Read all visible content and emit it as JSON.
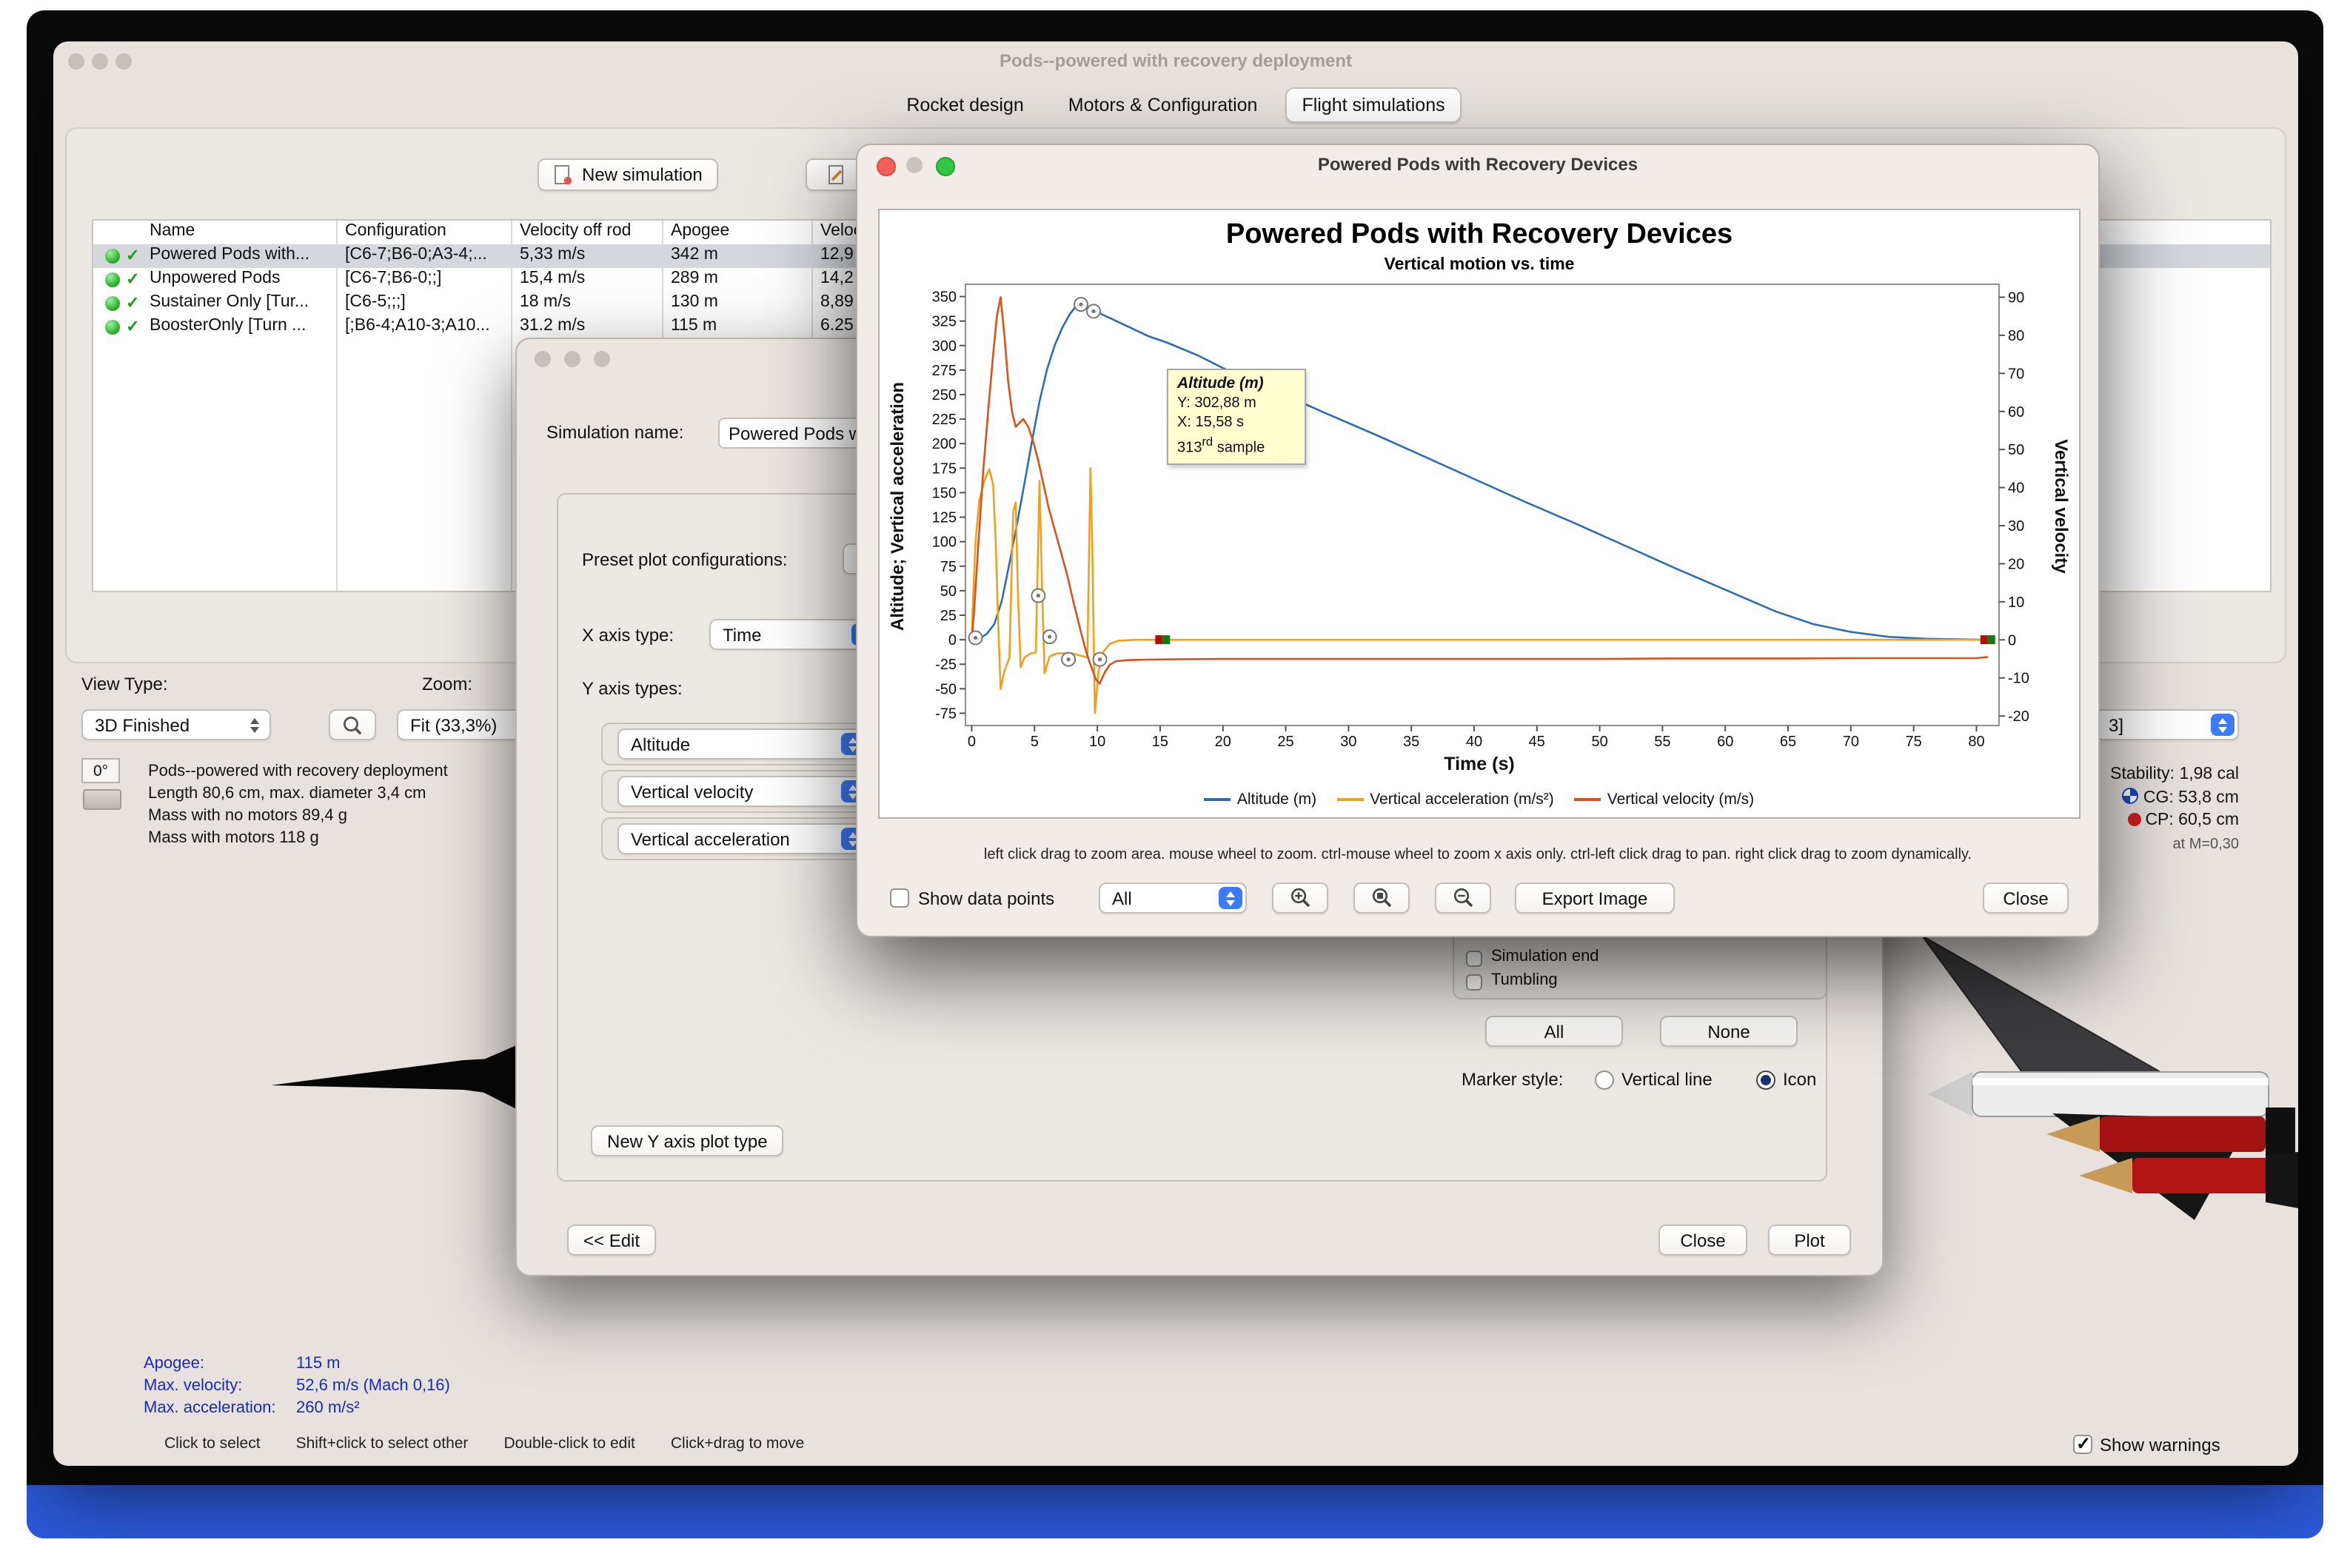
{
  "colors": {
    "accent_blue": "#3d7af5",
    "dock_blue": "#2b59d8",
    "selection": "#d4d8dc",
    "altitude": "#2e6db4",
    "acceleration": "#f0a01e",
    "velocity": "#d8521a"
  },
  "window": {
    "title": "Pods--powered with recovery deployment",
    "tabs": [
      "Rocket design",
      "Motors & Configuration",
      "Flight simulations"
    ],
    "active_tab": "Flight simulations",
    "toolbar": {
      "new_simulation": "New simulation",
      "edit_fragment": "E"
    },
    "table": {
      "columns": [
        "Name",
        "Configuration",
        "Velocity off rod",
        "Apogee",
        "Veloc"
      ],
      "rows": [
        {
          "name": "Powered Pods with...",
          "configuration": "[C6-7;B6-0;A3-4;...",
          "velocity_off_rod": "5,33 m/s",
          "apogee": "342 m",
          "velocity_deploy": "12,9"
        },
        {
          "name": "Unpowered Pods",
          "configuration": "[C6-7;B6-0;;]",
          "velocity_off_rod": "15,4 m/s",
          "apogee": "289 m",
          "velocity_deploy": "14,2"
        },
        {
          "name": "Sustainer Only [Tur...",
          "configuration": "[C6-5;;;]",
          "velocity_off_rod": "18 m/s",
          "apogee": "130 m",
          "velocity_deploy": "8,89"
        },
        {
          "name": "BoosterOnly [Turn ...",
          "configuration": "[;B6-4;A10-3;A10...",
          "velocity_off_rod": "31.2 m/s",
          "apogee": "115 m",
          "velocity_deploy": "6.25"
        }
      ]
    },
    "view": {
      "view_type_label": "View Type:",
      "view_type_value": "3D Finished",
      "zoom_label": "Zoom:",
      "zoom_value": "Fit (33,3%)",
      "rotation": "0°"
    },
    "rocket_info": [
      "Pods--powered with recovery deployment",
      "Length 80,6 cm, max. diameter 3,4 cm",
      "Mass with no motors 89,4 g",
      "Mass with motors 118 g"
    ],
    "flight_stats": {
      "apogee_label": "Apogee:",
      "apogee_value": "115 m",
      "velocity_label": "Max. velocity:",
      "velocity_value": "52,6 m/s  (Mach 0,16)",
      "accel_label": "Max. acceleration:",
      "accel_value": "260 m/s²"
    },
    "stability": {
      "config_fragment": "3]",
      "stability": "Stability: 1,98 cal",
      "cg": "CG: 53,8 cm",
      "cp": "CP: 60,5 cm",
      "mach": "at M=0,30"
    },
    "status_bar": {
      "hints": [
        "Click to select",
        "Shift+click to select other",
        "Double-click to edit",
        "Click+drag to move"
      ],
      "show_warnings": "Show warnings"
    }
  },
  "edit_dialog": {
    "simulation_name_label": "Simulation name:",
    "simulation_name_value": "Powered Pods w",
    "preset_label": "Preset plot configurations:",
    "x_axis_label": "X axis type:",
    "x_axis_value": "Time",
    "y_axis_label": "Y axis types:",
    "y_axis_types": [
      "Altitude",
      "Vertical velocity",
      "Vertical acceleration"
    ],
    "events": [
      "Simulation end",
      "Tumbling"
    ],
    "all_button": "All",
    "none_button": "None",
    "marker_style_label": "Marker style:",
    "marker_options": [
      "Vertical line",
      "Icon"
    ],
    "marker_selected": "Icon",
    "new_y_axis_button": "New Y axis plot type",
    "edit_button": "<< Edit",
    "close_button": "Close",
    "plot_button": "Plot"
  },
  "plot_dialog": {
    "title": "Powered Pods with Recovery Devices",
    "hint": "left click drag to zoom area. mouse wheel to zoom. ctrl-mouse wheel to zoom x axis only. ctrl-left click drag to pan.  right click drag to zoom dynamically.",
    "show_data_points": "Show data points",
    "events_dropdown": "All",
    "export_button": "Export Image",
    "close_button": "Close",
    "tooltip": {
      "title": "Altitude (m)",
      "y_line": "Y: 302,88 m",
      "x_line": "X: 15,58 s",
      "sample_num": "313",
      "sample_sup": "rd",
      "sample_word": " sample"
    }
  },
  "chart_data": {
    "type": "line",
    "title": "Powered Pods with Recovery Devices",
    "subtitle": "Vertical motion vs. time",
    "xlabel": "Time (s)",
    "ylabel_left": "Altitude; Vertical acceleration",
    "ylabel_right": "Vertical velocity",
    "xlim": [
      -0.5,
      81.8
    ],
    "ylim_left": [
      -87.5,
      362.5
    ],
    "ylim_right": [
      -22.5,
      93.4
    ],
    "x_ticks": [
      0,
      5,
      10,
      15,
      20,
      25,
      30,
      35,
      40,
      45,
      50,
      55,
      60,
      65,
      70,
      75,
      80
    ],
    "left_ticks": [
      -75,
      -50,
      -25,
      0,
      25,
      50,
      75,
      100,
      125,
      150,
      175,
      200,
      225,
      250,
      275,
      300,
      325,
      350
    ],
    "right_ticks": [
      -20,
      -10,
      0,
      10,
      20,
      30,
      40,
      50,
      60,
      70,
      80,
      90
    ],
    "grid": false,
    "legend_position": "bottom",
    "series": [
      {
        "name": "Altitude (m)",
        "color": "#2e6db4",
        "axis": "left",
        "points": [
          [
            0,
            0
          ],
          [
            0.6,
            1
          ],
          [
            1.2,
            6
          ],
          [
            1.8,
            16
          ],
          [
            2.4,
            40
          ],
          [
            3,
            78
          ],
          [
            3.6,
            118
          ],
          [
            4.2,
            160
          ],
          [
            4.8,
            203
          ],
          [
            5.4,
            243
          ],
          [
            6,
            276
          ],
          [
            6.6,
            300
          ],
          [
            7.2,
            318
          ],
          [
            7.8,
            332
          ],
          [
            8.3,
            340
          ],
          [
            8.7,
            342
          ],
          [
            9.3,
            339
          ],
          [
            10,
            334
          ],
          [
            11,
            328
          ],
          [
            12,
            322
          ],
          [
            14,
            310
          ],
          [
            15.58,
            302.88
          ],
          [
            18,
            290
          ],
          [
            20,
            277
          ],
          [
            24,
            255
          ],
          [
            28,
            232
          ],
          [
            32,
            210
          ],
          [
            36,
            187
          ],
          [
            40,
            164
          ],
          [
            44,
            141
          ],
          [
            48,
            119
          ],
          [
            52,
            96
          ],
          [
            56,
            73
          ],
          [
            60,
            51
          ],
          [
            64,
            29
          ],
          [
            67,
            16
          ],
          [
            70,
            8
          ],
          [
            73,
            3
          ],
          [
            76,
            1
          ],
          [
            81,
            0
          ]
        ]
      },
      {
        "name": "Vertical acceleration (m/s²)",
        "color": "#f0a01e",
        "axis": "left",
        "points": [
          [
            0,
            0
          ],
          [
            0.1,
            40
          ],
          [
            0.3,
            100
          ],
          [
            0.6,
            142
          ],
          [
            1,
            162
          ],
          [
            1.4,
            174
          ],
          [
            1.7,
            158
          ],
          [
            1.9,
            100
          ],
          [
            2.1,
            18
          ],
          [
            2.3,
            -50
          ],
          [
            2.6,
            -32
          ],
          [
            3,
            -18
          ],
          [
            3.3,
            130
          ],
          [
            3.5,
            140
          ],
          [
            3.7,
            40
          ],
          [
            3.9,
            -28
          ],
          [
            4.2,
            -18
          ],
          [
            4.7,
            -14
          ],
          [
            5.1,
            -13
          ],
          [
            5.4,
            162
          ],
          [
            5.6,
            55
          ],
          [
            5.8,
            -34
          ],
          [
            6.2,
            -17
          ],
          [
            6.8,
            -14
          ],
          [
            7.4,
            -14
          ],
          [
            8,
            -14
          ],
          [
            8.6,
            -16
          ],
          [
            9.2,
            -18
          ],
          [
            9.45,
            175
          ],
          [
            9.6,
            90
          ],
          [
            9.8,
            -75
          ],
          [
            10.1,
            -32
          ],
          [
            10.5,
            -12
          ],
          [
            11,
            -4
          ],
          [
            11.7,
            -1
          ],
          [
            13,
            0
          ],
          [
            16,
            0
          ],
          [
            20,
            0
          ],
          [
            25,
            0
          ],
          [
            30,
            0
          ],
          [
            40,
            0
          ],
          [
            50,
            0
          ],
          [
            60,
            0
          ],
          [
            70,
            0
          ],
          [
            81,
            0
          ]
        ]
      },
      {
        "name": "Vertical velocity (m/s)",
        "color": "#d8521a",
        "axis": "right",
        "points": [
          [
            0,
            0
          ],
          [
            0.2,
            8
          ],
          [
            0.5,
            24
          ],
          [
            0.9,
            44
          ],
          [
            1.3,
            60
          ],
          [
            1.7,
            75
          ],
          [
            2,
            85
          ],
          [
            2.3,
            90
          ],
          [
            2.6,
            80
          ],
          [
            2.9,
            68
          ],
          [
            3.2,
            60
          ],
          [
            3.5,
            56
          ],
          [
            3.8,
            57
          ],
          [
            4.1,
            58
          ],
          [
            4.5,
            56
          ],
          [
            4.9,
            52
          ],
          [
            5.3,
            47
          ],
          [
            5.7,
            41
          ],
          [
            6.1,
            35
          ],
          [
            6.6,
            29
          ],
          [
            7.1,
            23
          ],
          [
            7.6,
            17
          ],
          [
            8.1,
            10
          ],
          [
            8.7,
            2
          ],
          [
            9.1,
            -3
          ],
          [
            9.5,
            -7
          ],
          [
            9.9,
            -10.5
          ],
          [
            10.2,
            -11.5
          ],
          [
            10.6,
            -8.5
          ],
          [
            11,
            -6.5
          ],
          [
            11.5,
            -5.6
          ],
          [
            12.5,
            -5.3
          ],
          [
            14,
            -5.2
          ],
          [
            16,
            -5.1
          ],
          [
            20,
            -5
          ],
          [
            25,
            -5
          ],
          [
            30,
            -5
          ],
          [
            35,
            -5
          ],
          [
            40,
            -5
          ],
          [
            45,
            -5
          ],
          [
            50,
            -5
          ],
          [
            55,
            -4.9
          ],
          [
            60,
            -4.9
          ],
          [
            65,
            -4.9
          ],
          [
            70,
            -4.8
          ],
          [
            75,
            -4.8
          ],
          [
            80,
            -4.8
          ],
          [
            80.9,
            -4.5
          ]
        ]
      }
    ],
    "event_markers": [
      {
        "x": 0.3,
        "v": 2
      },
      {
        "x": 5.3,
        "v": 45
      },
      {
        "x": 6.2,
        "v": 3
      },
      {
        "x": 7.7,
        "v": -20
      },
      {
        "x": 8.7,
        "v": 342
      },
      {
        "x": 9.7,
        "v": 335
      },
      {
        "x": 10.2,
        "v": -20
      }
    ],
    "flag_markers": [
      {
        "x": 15.2
      },
      {
        "x": 80.9
      }
    ],
    "tooltip_point": {
      "x": 15.58,
      "y": 302.88,
      "sample": 313
    }
  }
}
